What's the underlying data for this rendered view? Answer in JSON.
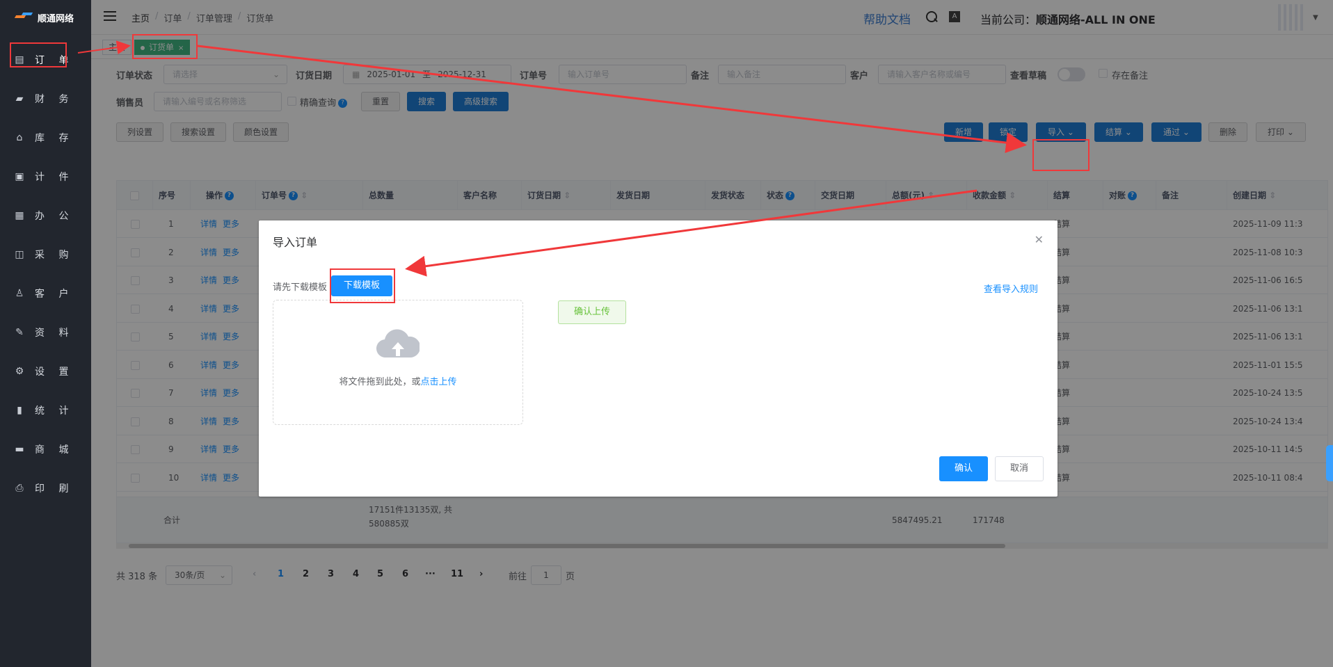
{
  "app": {
    "logo_text": "顺通网络"
  },
  "sidebar": {
    "items": [
      {
        "icon": "document-icon",
        "label": "订 单",
        "active": true
      },
      {
        "icon": "wallet-icon",
        "label": "财 务"
      },
      {
        "icon": "home-icon",
        "label": "库 存"
      },
      {
        "icon": "clipboard-icon",
        "label": "计 件"
      },
      {
        "icon": "calendar-icon",
        "label": "办 公"
      },
      {
        "icon": "bag-icon",
        "label": "采 购"
      },
      {
        "icon": "user-icon",
        "label": "客 户"
      },
      {
        "icon": "edit-icon",
        "label": "资 料"
      },
      {
        "icon": "gear-icon",
        "label": "设 置"
      },
      {
        "icon": "bar-chart-icon",
        "label": "统 计"
      },
      {
        "icon": "shop-icon",
        "label": "商 城"
      },
      {
        "icon": "printer-icon",
        "label": "印 刷"
      }
    ]
  },
  "header": {
    "breadcrumb": [
      "主页",
      "订单",
      "订单管理",
      "订货单"
    ],
    "help": "帮助文档",
    "company_prefix": "当前公司：",
    "company_name": "顺通网络-ALL IN ONE"
  },
  "tags": {
    "home": "主页",
    "active": "订货单",
    "close": "×"
  },
  "filters": {
    "status_label": "订单状态",
    "status_placeholder": "请选择",
    "date_label": "订货日期",
    "date_start": "2025-01-01",
    "date_sep": "至",
    "date_end": "2025-12-31",
    "order_no_label": "订单号",
    "order_no_placeholder": "输入订单号",
    "remark_label": "备注",
    "remark_placeholder": "输入备注",
    "customer_label": "客户",
    "customer_placeholder": "请输入客户名称或编号",
    "draft_label": "查看草稿",
    "has_remark_label": "存在备注",
    "sales_label": "销售员",
    "sales_placeholder": "请输入编号或名称筛选",
    "exact_label": "精确查询",
    "reset": "重置",
    "search": "搜索",
    "advanced": "高级搜索"
  },
  "toolbar": {
    "col_settings": "列设置",
    "search_settings": "搜索设置",
    "color_settings": "颜色设置",
    "add": "新增",
    "lock": "锁定",
    "import": "导入",
    "settle": "结算",
    "pass": "通过",
    "delete": "删除",
    "print": "打印"
  },
  "table": {
    "columns": [
      "序号",
      "操作",
      "订单号",
      "总数量",
      "客户名称",
      "订货日期",
      "发货日期",
      "发货状态",
      "状态",
      "交货日期",
      "总额(元)",
      "收款金额",
      "结算",
      "对账",
      "备注",
      "创建日期"
    ],
    "rows": [
      {
        "no": "1",
        "settle": "结算",
        "created": "2025-11-09 11:3"
      },
      {
        "no": "2",
        "settle": "结算",
        "created": "2025-11-08 10:3"
      },
      {
        "no": "3",
        "settle": "结算",
        "created": "2025-11-06 16:5"
      },
      {
        "no": "4",
        "settle": "结算",
        "created": "2025-11-06 13:1"
      },
      {
        "no": "5",
        "settle": "结算",
        "created": "2025-11-06 13:1"
      },
      {
        "no": "6",
        "settle": "结算",
        "created": "2025-11-01 15:5"
      },
      {
        "no": "7",
        "settle": "结算",
        "created": "2025-10-24 13:5"
      },
      {
        "no": "8",
        "settle": "结算",
        "created": "2025-10-24 13:4"
      },
      {
        "no": "9",
        "settle": "结算",
        "created": "2025-10-11 14:5"
      },
      {
        "no": "10",
        "settle": "结算",
        "created": "2025-10-11 08:4"
      }
    ],
    "action_detail": "详情",
    "action_more": "更多",
    "summary": {
      "label": "合计",
      "quantity_line1": "17151件13135双, 共",
      "quantity_line2": "580885双",
      "total": "5847495.21",
      "received": "171748"
    }
  },
  "pagination": {
    "total": "共 318 条",
    "page_size": "30条/页",
    "pages": [
      "1",
      "2",
      "3",
      "4",
      "5",
      "6",
      "···",
      "11"
    ],
    "goto_prefix": "前往",
    "goto_value": "1",
    "goto_suffix": "页"
  },
  "dialog": {
    "title": "导入订单",
    "hint": "请先下载模板",
    "download": "下载模板",
    "rules": "查看导入规则",
    "upload_text": "将文件拖到此处，或",
    "upload_link": "点击上传",
    "confirm_upload": "确认上传",
    "ok": "确认",
    "cancel": "取消"
  },
  "colors": {
    "primary": "#1890ff",
    "sidebar": "#22262e",
    "annotation": "#f0383a",
    "tag_active": "#42b983"
  }
}
